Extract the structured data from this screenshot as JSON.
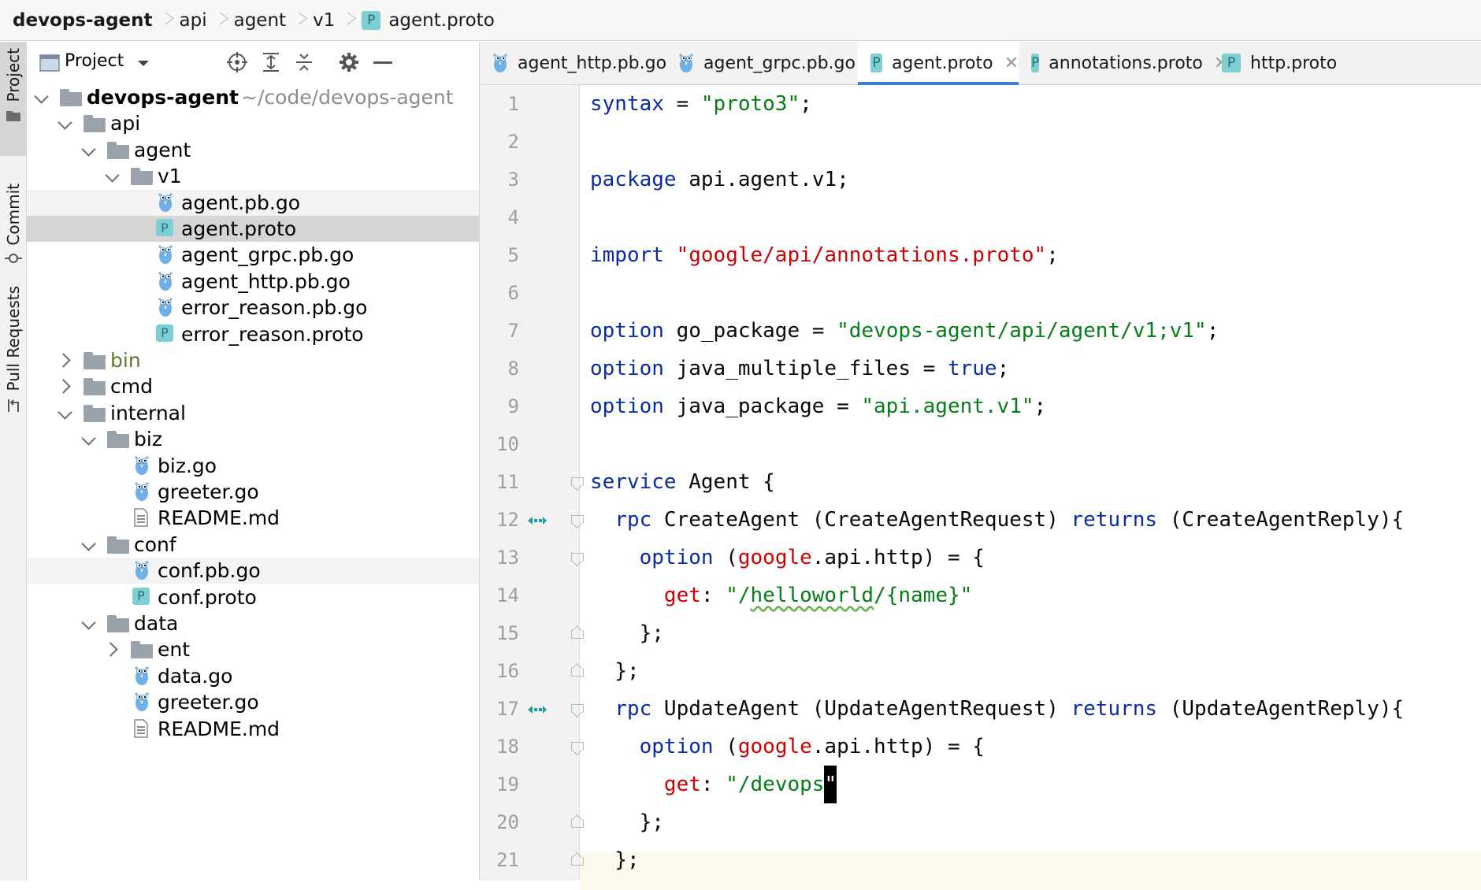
{
  "breadcrumb": {
    "items": [
      "devops-agent",
      "api",
      "agent",
      "v1",
      "agent.proto"
    ],
    "file_icon": "P"
  },
  "left_strip": {
    "tabs": [
      "Project",
      "Commit",
      "Pull Requests"
    ]
  },
  "project_panel": {
    "title": "Project",
    "tree": [
      {
        "label": "devops-agent",
        "extra": "~/code/devops-agent",
        "icon": "folder-icon",
        "expanded": true
      },
      {
        "label": "api",
        "icon": "folder-icon",
        "expanded": true
      },
      {
        "label": "agent",
        "icon": "folder-icon",
        "expanded": true
      },
      {
        "label": "v1",
        "icon": "folder-icon",
        "expanded": true
      },
      {
        "label": "agent.pb.go",
        "icon": "gopher-icon"
      },
      {
        "label": "agent.proto",
        "icon": "proto-icon",
        "selected": true
      },
      {
        "label": "agent_grpc.pb.go",
        "icon": "gopher-icon"
      },
      {
        "label": "agent_http.pb.go",
        "icon": "gopher-icon"
      },
      {
        "label": "error_reason.pb.go",
        "icon": "gopher-icon"
      },
      {
        "label": "error_reason.proto",
        "icon": "proto-icon"
      },
      {
        "label": "bin",
        "icon": "folder-icon",
        "expanded": false,
        "color": "#5a7a2e"
      },
      {
        "label": "cmd",
        "icon": "folder-icon",
        "expanded": false
      },
      {
        "label": "internal",
        "icon": "folder-icon",
        "expanded": true
      },
      {
        "label": "biz",
        "icon": "folder-icon",
        "expanded": true
      },
      {
        "label": "biz.go",
        "icon": "gopher-icon"
      },
      {
        "label": "greeter.go",
        "icon": "gopher-icon"
      },
      {
        "label": "README.md",
        "icon": "text-file-icon"
      },
      {
        "label": "conf",
        "icon": "folder-icon",
        "expanded": true
      },
      {
        "label": "conf.pb.go",
        "icon": "gopher-icon"
      },
      {
        "label": "conf.proto",
        "icon": "proto-icon"
      },
      {
        "label": "data",
        "icon": "folder-icon",
        "expanded": true
      },
      {
        "label": "ent",
        "icon": "folder-icon",
        "expanded": false
      },
      {
        "label": "data.go",
        "icon": "gopher-icon"
      },
      {
        "label": "greeter.go",
        "icon": "gopher-icon"
      },
      {
        "label": "README.md",
        "icon": "text-file-icon"
      }
    ]
  },
  "tabs": [
    {
      "label": "agent_http.pb.go",
      "icon": "gopher-icon"
    },
    {
      "label": "agent_grpc.pb.go",
      "icon": "gopher-icon"
    },
    {
      "label": "agent.proto",
      "icon": "proto-icon",
      "active": true
    },
    {
      "label": "annotations.proto",
      "icon": "proto-icon"
    },
    {
      "label": "http.proto",
      "icon": "proto-icon"
    }
  ],
  "editor": {
    "current_line": 19,
    "lines": [
      [
        [
          "kw",
          "syntax"
        ],
        [
          "plain",
          " = "
        ],
        [
          "str",
          "\"proto3\""
        ],
        [
          "plain",
          ";"
        ]
      ],
      [],
      [
        [
          "kw",
          "package"
        ],
        [
          "plain",
          " api.agent.v1;"
        ]
      ],
      [],
      [
        [
          "kw",
          "import"
        ],
        [
          "plain",
          " "
        ],
        [
          "red",
          "\"google/api/annotations.proto\""
        ],
        [
          "plain",
          ";"
        ]
      ],
      [],
      [
        [
          "kw",
          "option"
        ],
        [
          "plain",
          " go_package = "
        ],
        [
          "str",
          "\"devops-agent/api/agent/v1;v1\""
        ],
        [
          "plain",
          ";"
        ]
      ],
      [
        [
          "kw",
          "option"
        ],
        [
          "plain",
          " java_multiple_files = "
        ],
        [
          "kw",
          "true"
        ],
        [
          "plain",
          ";"
        ]
      ],
      [
        [
          "kw",
          "option"
        ],
        [
          "plain",
          " java_package = "
        ],
        [
          "str",
          "\"api.agent.v1\""
        ],
        [
          "plain",
          ";"
        ]
      ],
      [],
      [
        [
          "kw",
          "service"
        ],
        [
          "plain",
          " Agent {"
        ]
      ],
      [
        [
          "plain",
          "  "
        ],
        [
          "kw",
          "rpc"
        ],
        [
          "plain",
          " CreateAgent (CreateAgentRequest) "
        ],
        [
          "kw",
          "returns"
        ],
        [
          "plain",
          " (CreateAgentReply){"
        ]
      ],
      [
        [
          "plain",
          "    "
        ],
        [
          "kw",
          "option"
        ],
        [
          "plain",
          " ("
        ],
        [
          "red",
          "google"
        ],
        [
          "plain",
          ".api.http) = {"
        ]
      ],
      [
        [
          "plain",
          "      "
        ],
        [
          "red",
          "get"
        ],
        [
          "plain",
          ": "
        ],
        [
          "str",
          "\"/"
        ],
        [
          "squig",
          "helloworld"
        ],
        [
          "str",
          "/{name}\""
        ]
      ],
      [
        [
          "plain",
          "    };"
        ]
      ],
      [
        [
          "plain",
          "  };"
        ]
      ],
      [
        [
          "plain",
          "  "
        ],
        [
          "kw",
          "rpc"
        ],
        [
          "plain",
          " UpdateAgent (UpdateAgentRequest) "
        ],
        [
          "kw",
          "returns"
        ],
        [
          "plain",
          " (UpdateAgentReply){"
        ]
      ],
      [
        [
          "plain",
          "    "
        ],
        [
          "kw",
          "option"
        ],
        [
          "plain",
          " ("
        ],
        [
          "red",
          "google"
        ],
        [
          "plain",
          ".api.http) = {"
        ]
      ],
      [
        [
          "plain",
          "      "
        ],
        [
          "red",
          "get"
        ],
        [
          "plain",
          ": "
        ],
        [
          "str",
          "\"/devops"
        ],
        [
          "caret",
          "\""
        ]
      ],
      [
        [
          "plain",
          "    };"
        ]
      ],
      [
        [
          "plain",
          "  };"
        ]
      ]
    ]
  }
}
